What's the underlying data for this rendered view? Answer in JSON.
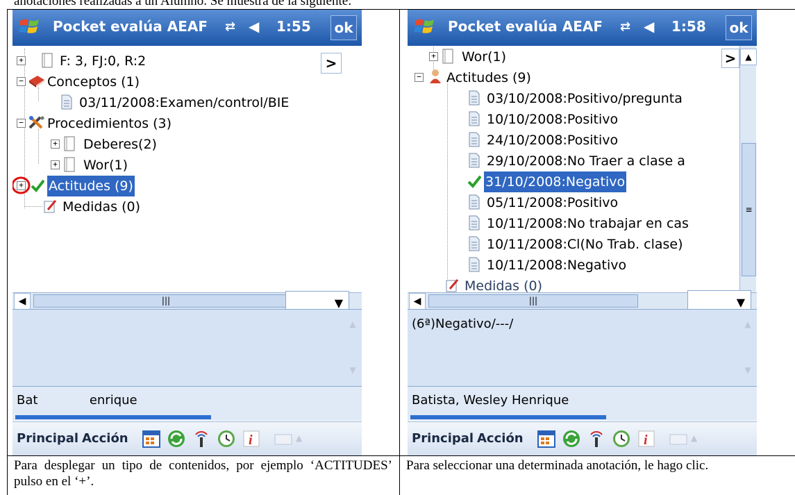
{
  "top_text": "anotaciones realizadas a un Alumno. Se muestra de la siguiente:",
  "left_caption": "Para desplegar un tipo de contenidos, por ejemplo ‘ACTITUDES’ pulso en el ‘+’.",
  "right_caption": "Para seleccionar una determinada anotación, le hago clic.",
  "left_screen": {
    "title": "Pocket evalúa AEAF",
    "clock": "1:55",
    "ok": "ok",
    "nav_arrow": ">",
    "tree": [
      {
        "label": "F: 3, FJ:0, R:2",
        "icon": "notebook-icon"
      },
      {
        "label": "Conceptos (1)",
        "icon": "book-icon"
      },
      {
        "label": "03/11/2008:Examen/control/BIE",
        "icon": "document-icon"
      },
      {
        "label": "Procedimientos (3)",
        "icon": "tools-icon"
      },
      {
        "label": "Deberes(2)",
        "icon": "notebook-icon"
      },
      {
        "label": "Wor(1)",
        "icon": "notebook-icon"
      },
      {
        "label": "Actitudes (9)",
        "icon": "checkmark-icon",
        "selected": true
      },
      {
        "label": "Medidas (0)",
        "icon": "edit-icon"
      }
    ],
    "notes_text": "",
    "student_name": "Bat             enrique",
    "progress": 0.56,
    "menu_principal": "Principal",
    "menu_accion": "Acción"
  },
  "right_screen": {
    "title": "Pocket evalúa AEAF",
    "clock": "1:58",
    "ok": "ok",
    "nav_arrow": ">",
    "tree": [
      {
        "label": "Wor(1)",
        "icon": "notebook-icon"
      },
      {
        "label": "Actitudes (9)",
        "icon": "person-icon"
      },
      {
        "label": "03/10/2008:Positivo/pregunta",
        "icon": "document-icon"
      },
      {
        "label": "10/10/2008:Positivo",
        "icon": "document-icon"
      },
      {
        "label": "24/10/2008:Positivo",
        "icon": "document-icon"
      },
      {
        "label": "29/10/2008:No Traer a clase a",
        "icon": "document-icon"
      },
      {
        "label": "31/10/2008:Negativo",
        "icon": "checkmark-icon",
        "selected": true
      },
      {
        "label": "05/11/2008:Positivo",
        "icon": "document-icon"
      },
      {
        "label": "10/11/2008:No trabajar en cas",
        "icon": "document-icon"
      },
      {
        "label": "10/11/2008:Cl(No Trab. clase)",
        "icon": "document-icon"
      },
      {
        "label": "10/11/2008:Negativo",
        "icon": "document-icon"
      },
      {
        "label": "Medidas (0)",
        "icon": "edit-icon"
      }
    ],
    "notes_text": "(6ª)Negativo/---/",
    "student_name": "Batista, Wesley Henrique",
    "progress": 0.56,
    "menu_principal": "Principal",
    "menu_accion": "Acción"
  }
}
